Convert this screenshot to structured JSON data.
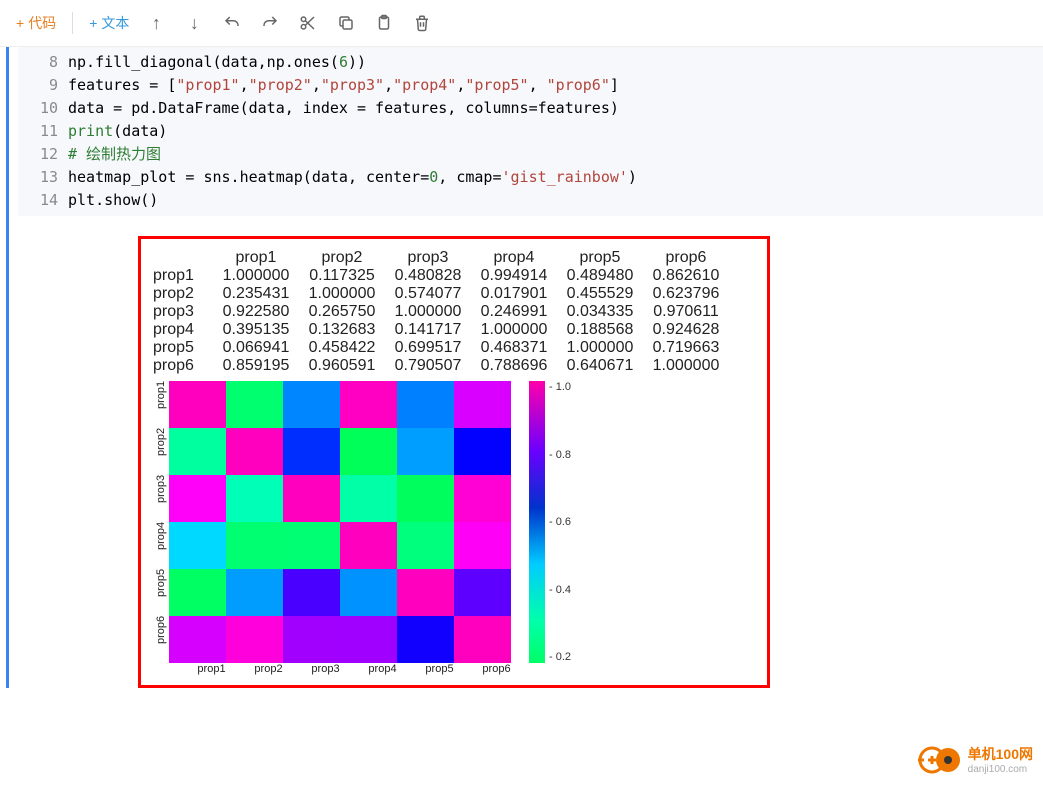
{
  "toolbar": {
    "code_label": "代码",
    "text_label": "文本"
  },
  "code": {
    "lines": [
      {
        "n": "8",
        "raw": "np.fill_diagonal(data,np.ones(6))"
      },
      {
        "n": "9",
        "raw": "features = [\"prop1\",\"prop2\",\"prop3\",\"prop4\",\"prop5\", \"prop6\"]"
      },
      {
        "n": "10",
        "raw": "data = pd.DataFrame(data, index = features, columns=features)"
      },
      {
        "n": "11",
        "raw": "print(data)"
      },
      {
        "n": "12",
        "raw": "# 绘制热力图"
      },
      {
        "n": "13",
        "raw": "heatmap_plot = sns.heatmap(data, center=0, cmap='gist_rainbow')"
      },
      {
        "n": "14",
        "raw": "plt.show()"
      }
    ]
  },
  "output_table": {
    "columns": [
      "prop1",
      "prop2",
      "prop3",
      "prop4",
      "prop5",
      "prop6"
    ],
    "rows": [
      {
        "label": "prop1",
        "vals": [
          "1.000000",
          "0.117325",
          "0.480828",
          "0.994914",
          "0.489480",
          "0.862610"
        ]
      },
      {
        "label": "prop2",
        "vals": [
          "0.235431",
          "1.000000",
          "0.574077",
          "0.017901",
          "0.455529",
          "0.623796"
        ]
      },
      {
        "label": "prop3",
        "vals": [
          "0.922580",
          "0.265750",
          "1.000000",
          "0.246991",
          "0.034335",
          "0.970611"
        ]
      },
      {
        "label": "prop4",
        "vals": [
          "0.395135",
          "0.132683",
          "0.141717",
          "1.000000",
          "0.188568",
          "0.924628"
        ]
      },
      {
        "label": "prop5",
        "vals": [
          "0.066941",
          "0.458422",
          "0.699517",
          "0.468371",
          "1.000000",
          "0.719663"
        ]
      },
      {
        "label": "prop6",
        "vals": [
          "0.859195",
          "0.960591",
          "0.790507",
          "0.788696",
          "0.640671",
          "1.000000"
        ]
      }
    ]
  },
  "chart_data": {
    "type": "heatmap",
    "cmap": "gist_rainbow",
    "center": 0,
    "x_labels": [
      "prop1",
      "prop2",
      "prop3",
      "prop4",
      "prop5",
      "prop6"
    ],
    "y_labels": [
      "prop1",
      "prop2",
      "prop3",
      "prop4",
      "prop5",
      "prop6"
    ],
    "values": [
      [
        1.0,
        0.117325,
        0.480828,
        0.994914,
        0.48948,
        0.86261
      ],
      [
        0.235431,
        1.0,
        0.574077,
        0.017901,
        0.455529,
        0.623796
      ],
      [
        0.92258,
        0.26575,
        1.0,
        0.246991,
        0.034335,
        0.970611
      ],
      [
        0.395135,
        0.132683,
        0.141717,
        1.0,
        0.188568,
        0.924628
      ],
      [
        0.066941,
        0.458422,
        0.699517,
        0.468371,
        1.0,
        0.719663
      ],
      [
        0.859195,
        0.960591,
        0.790507,
        0.788696,
        0.640671,
        1.0
      ]
    ],
    "colorbar_ticks": [
      "1.0",
      "0.8",
      "0.6",
      "0.4",
      "0.2"
    ]
  },
  "watermark": {
    "name": "单机100网",
    "url": "danji100.com"
  }
}
